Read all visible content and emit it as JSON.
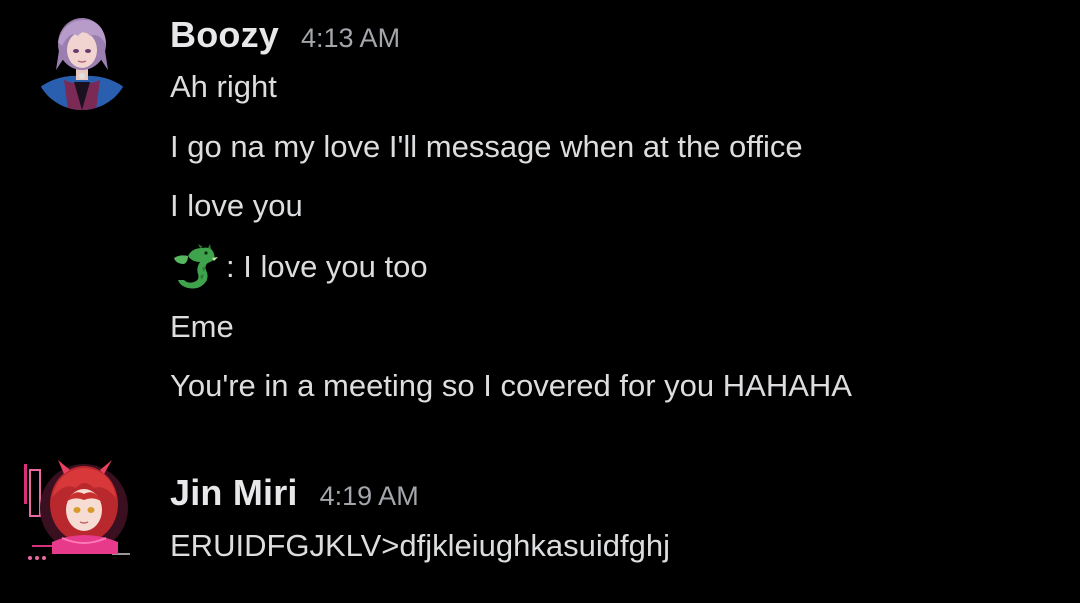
{
  "messages": [
    {
      "author": "Boozy",
      "time": "4:13 AM",
      "avatar_icon": "avatar-anime-man-purple-hair",
      "lines": [
        "Ah right",
        "I go na my love I'll message when at the office",
        "I love you",
        ": I love you too",
        "Eme",
        "You're in a meeting so I covered for you HAHAHA"
      ],
      "emoji_line_4": "dragon-emoji"
    },
    {
      "author": "Jin Miri",
      "time": "4:19 AM",
      "avatar_icon": "avatar-anime-girl-red-hair",
      "lines": [
        "ERUIDFGJKLV>dfjkleiughkasuidfghj"
      ]
    }
  ],
  "colors": {
    "background": "#000000",
    "username": "#e8e8ea",
    "timestamp": "#a3a6aa",
    "message_text": "#dcddde",
    "dragon": "#3fa34d"
  }
}
